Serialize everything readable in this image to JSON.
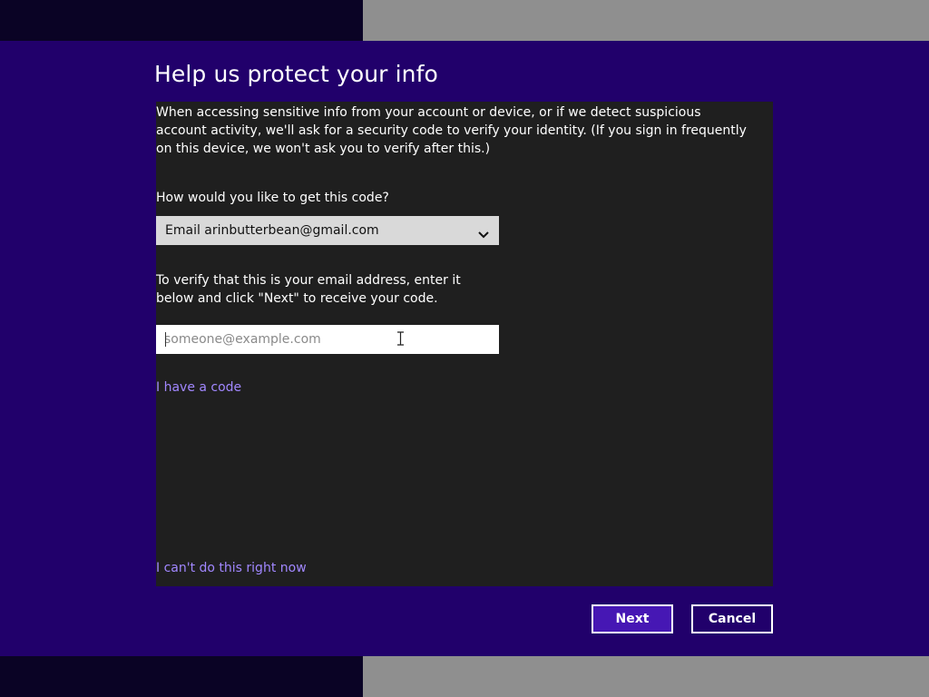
{
  "dialog": {
    "title": "Help us protect your info",
    "description": "When accessing sensitive info from your account or device, or if we detect suspicious account activity, we'll ask for a security code to verify your identity. (If you sign in frequently on this device, we won't ask you to verify after this.)",
    "code_question": "How would you like to get this code?",
    "method_select": {
      "selected": "Email arinbutterbean@gmail.com",
      "icon": "chevron-down-icon"
    },
    "verify_instructions": "To verify that this is your email address, enter it below and click \"Next\" to receive your code.",
    "email_field": {
      "value": "",
      "placeholder": "someone@example.com"
    },
    "have_code_link": "I have a code",
    "cant_do_link": "I can't do this right now",
    "next_button": "Next",
    "cancel_button": "Cancel"
  },
  "colors": {
    "dialog_background": "#21006b",
    "content_panel": "#1f1f1f",
    "link": "#a187ff",
    "primary_button": "#4617b4",
    "dark_strip": "#0a0325",
    "gray_strip": "#8f8f8f"
  }
}
